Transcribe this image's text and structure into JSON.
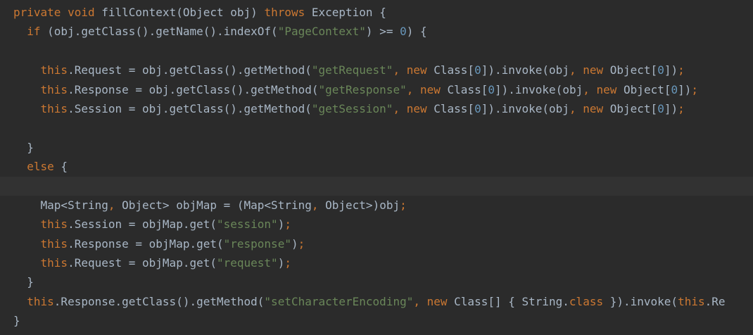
{
  "editor": {
    "theme": {
      "background": "#2b2b2b",
      "current_line_background": "#323232",
      "keyword_color": "#cc7832",
      "string_color": "#6a8759",
      "number_color": "#6897bb",
      "text_color": "#a9b7c6"
    },
    "lines": [
      {
        "indent": "",
        "tokens": [
          {
            "t": "kw",
            "v": "private"
          },
          {
            "t": "id",
            "v": " "
          },
          {
            "t": "kw",
            "v": "void"
          },
          {
            "t": "id",
            "v": " fillContext(Object obj) "
          },
          {
            "t": "kw",
            "v": "throws"
          },
          {
            "t": "id",
            "v": " Exception {"
          }
        ]
      },
      {
        "indent": "  ",
        "tokens": [
          {
            "t": "kw",
            "v": "if"
          },
          {
            "t": "id",
            "v": " (obj.getClass().getName().indexOf("
          },
          {
            "t": "str",
            "v": "\"PageContext\""
          },
          {
            "t": "id",
            "v": ") >= "
          },
          {
            "t": "num",
            "v": "0"
          },
          {
            "t": "id",
            "v": ") {"
          }
        ]
      },
      {
        "indent": "",
        "tokens": []
      },
      {
        "indent": "    ",
        "tokens": [
          {
            "t": "kw",
            "v": "this"
          },
          {
            "t": "id",
            "v": ".Request = obj.getClass().getMethod("
          },
          {
            "t": "str",
            "v": "\"getRequest\""
          },
          {
            "t": "punc-orange",
            "v": ","
          },
          {
            "t": "id",
            "v": " "
          },
          {
            "t": "kw",
            "v": "new"
          },
          {
            "t": "id",
            "v": " Class["
          },
          {
            "t": "num",
            "v": "0"
          },
          {
            "t": "id",
            "v": "]).invoke(obj"
          },
          {
            "t": "punc-orange",
            "v": ","
          },
          {
            "t": "id",
            "v": " "
          },
          {
            "t": "kw",
            "v": "new"
          },
          {
            "t": "id",
            "v": " Object["
          },
          {
            "t": "num",
            "v": "0"
          },
          {
            "t": "id",
            "v": "])"
          },
          {
            "t": "punc-orange",
            "v": ";"
          }
        ]
      },
      {
        "indent": "    ",
        "tokens": [
          {
            "t": "kw",
            "v": "this"
          },
          {
            "t": "id",
            "v": ".Response = obj.getClass().getMethod("
          },
          {
            "t": "str",
            "v": "\"getResponse\""
          },
          {
            "t": "punc-orange",
            "v": ","
          },
          {
            "t": "id",
            "v": " "
          },
          {
            "t": "kw",
            "v": "new"
          },
          {
            "t": "id",
            "v": " Class["
          },
          {
            "t": "num",
            "v": "0"
          },
          {
            "t": "id",
            "v": "]).invoke(obj"
          },
          {
            "t": "punc-orange",
            "v": ","
          },
          {
            "t": "id",
            "v": " "
          },
          {
            "t": "kw",
            "v": "new"
          },
          {
            "t": "id",
            "v": " Object["
          },
          {
            "t": "num",
            "v": "0"
          },
          {
            "t": "id",
            "v": "])"
          },
          {
            "t": "punc-orange",
            "v": ";"
          }
        ]
      },
      {
        "indent": "    ",
        "tokens": [
          {
            "t": "kw",
            "v": "this"
          },
          {
            "t": "id",
            "v": ".Session = obj.getClass().getMethod("
          },
          {
            "t": "str",
            "v": "\"getSession\""
          },
          {
            "t": "punc-orange",
            "v": ","
          },
          {
            "t": "id",
            "v": " "
          },
          {
            "t": "kw",
            "v": "new"
          },
          {
            "t": "id",
            "v": " Class["
          },
          {
            "t": "num",
            "v": "0"
          },
          {
            "t": "id",
            "v": "]).invoke(obj"
          },
          {
            "t": "punc-orange",
            "v": ","
          },
          {
            "t": "id",
            "v": " "
          },
          {
            "t": "kw",
            "v": "new"
          },
          {
            "t": "id",
            "v": " Object["
          },
          {
            "t": "num",
            "v": "0"
          },
          {
            "t": "id",
            "v": "])"
          },
          {
            "t": "punc-orange",
            "v": ";"
          }
        ]
      },
      {
        "indent": "",
        "tokens": []
      },
      {
        "indent": "  ",
        "tokens": [
          {
            "t": "id",
            "v": "}"
          }
        ]
      },
      {
        "indent": "  ",
        "tokens": [
          {
            "t": "kw",
            "v": "else"
          },
          {
            "t": "id",
            "v": " {"
          }
        ]
      },
      {
        "indent": "",
        "tokens": [],
        "current": true
      },
      {
        "indent": "    ",
        "tokens": [
          {
            "t": "id",
            "v": "Map<String"
          },
          {
            "t": "punc-orange",
            "v": ","
          },
          {
            "t": "id",
            "v": " Object> objMap = (Map<String"
          },
          {
            "t": "punc-orange",
            "v": ","
          },
          {
            "t": "id",
            "v": " Object>)obj"
          },
          {
            "t": "punc-orange",
            "v": ";"
          }
        ]
      },
      {
        "indent": "    ",
        "tokens": [
          {
            "t": "kw",
            "v": "this"
          },
          {
            "t": "id",
            "v": ".Session = objMap.get("
          },
          {
            "t": "str",
            "v": "\"session\""
          },
          {
            "t": "id",
            "v": ")"
          },
          {
            "t": "punc-orange",
            "v": ";"
          }
        ]
      },
      {
        "indent": "    ",
        "tokens": [
          {
            "t": "kw",
            "v": "this"
          },
          {
            "t": "id",
            "v": ".Response = objMap.get("
          },
          {
            "t": "str",
            "v": "\"response\""
          },
          {
            "t": "id",
            "v": ")"
          },
          {
            "t": "punc-orange",
            "v": ";"
          }
        ]
      },
      {
        "indent": "    ",
        "tokens": [
          {
            "t": "kw",
            "v": "this"
          },
          {
            "t": "id",
            "v": ".Request = objMap.get("
          },
          {
            "t": "str",
            "v": "\"request\""
          },
          {
            "t": "id",
            "v": ")"
          },
          {
            "t": "punc-orange",
            "v": ";"
          }
        ]
      },
      {
        "indent": "  ",
        "tokens": [
          {
            "t": "id",
            "v": "}"
          }
        ]
      },
      {
        "indent": "  ",
        "tokens": [
          {
            "t": "kw",
            "v": "this"
          },
          {
            "t": "id",
            "v": ".Response.getClass().getMethod("
          },
          {
            "t": "str",
            "v": "\"setCharacterEncoding\""
          },
          {
            "t": "punc-orange",
            "v": ","
          },
          {
            "t": "id",
            "v": " "
          },
          {
            "t": "kw",
            "v": "new"
          },
          {
            "t": "id",
            "v": " Class[] { String."
          },
          {
            "t": "kw",
            "v": "class"
          },
          {
            "t": "id",
            "v": " }).invoke("
          },
          {
            "t": "kw",
            "v": "this"
          },
          {
            "t": "id",
            "v": ".Re"
          }
        ]
      },
      {
        "indent": "",
        "tokens": [
          {
            "t": "id",
            "v": "}"
          }
        ]
      }
    ]
  }
}
